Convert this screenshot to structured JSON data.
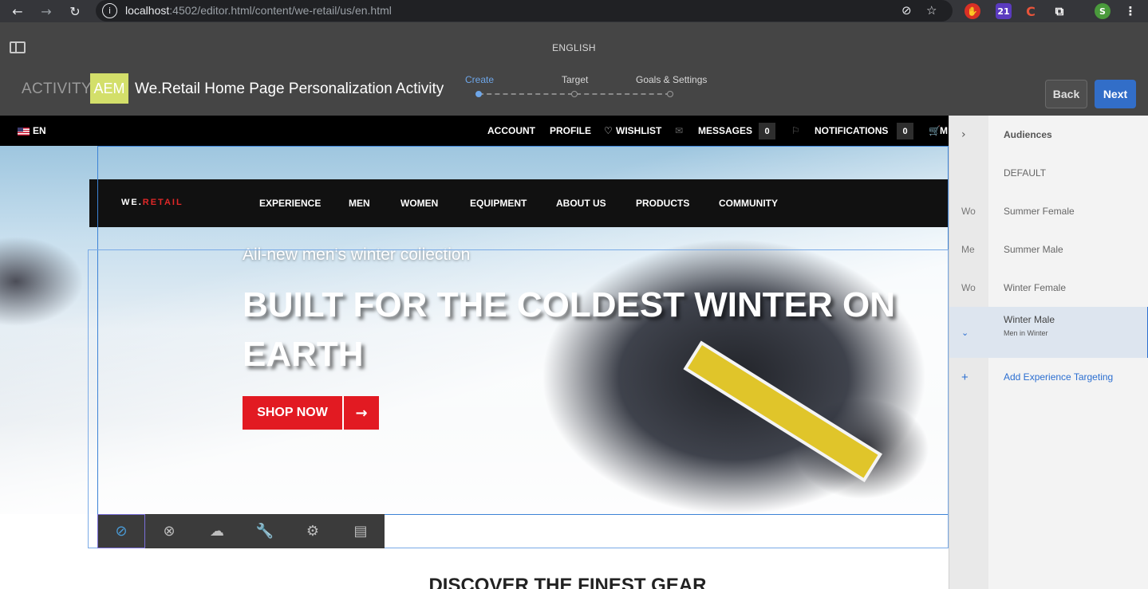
{
  "browser": {
    "url_host": "localhost",
    "url_rest": ":4502/editor.html/content/we-retail/us/en.html",
    "ext_badge_count": "21",
    "profile_initial": "S"
  },
  "editor": {
    "language": "ENGLISH",
    "activity_label": "ACTIVITY:",
    "aem_badge": "AEM",
    "activity_name": "We.Retail Home Page Personalization Activity",
    "steps": [
      "Create",
      "Target",
      "Goals & Settings"
    ],
    "current_step": "Create",
    "back_label": "Back",
    "next_label": "Next",
    "accent_color": "#326ec8"
  },
  "site": {
    "lang": "EN",
    "utility": {
      "account": "ACCOUNT",
      "profile": "PROFILE",
      "wishlist": "WISHLIST",
      "messages": "MESSAGES",
      "messages_count": "0",
      "notifications": "NOTIFICATIONS",
      "notifications_count": "0",
      "cart": "M"
    },
    "logo_a": "WE.",
    "logo_b": "RETAIL",
    "nav": [
      "EXPERIENCE",
      "MEN",
      "WOMEN",
      "EQUIPMENT",
      "ABOUT US",
      "PRODUCTS",
      "COMMUNITY"
    ],
    "hero_eyebrow": "All-new men's winter collection",
    "hero_title": "BUILT FOR THE COLDEST WINTER ON EARTH",
    "cta": "SHOP NOW",
    "section_heading": "DISCOVER THE FINEST GEAR",
    "brand_red": "#e21a22"
  },
  "toolbar": {
    "icons": [
      "no-target-icon",
      "close-icon",
      "upload-cloud-icon",
      "wrench-icon",
      "gear-icon",
      "table-icon"
    ]
  },
  "panel": {
    "header": "Audiences",
    "rows": [
      {
        "abbr": "",
        "name": "DEFAULT"
      },
      {
        "abbr": "Wo",
        "name": "Summer Female"
      },
      {
        "abbr": "Me",
        "name": "Summer Male"
      },
      {
        "abbr": "Wo",
        "name": "Winter Female"
      }
    ],
    "selected": {
      "name": "Winter Male",
      "sub": "Men in Winter"
    },
    "add_label": "Add Experience Targeting"
  }
}
